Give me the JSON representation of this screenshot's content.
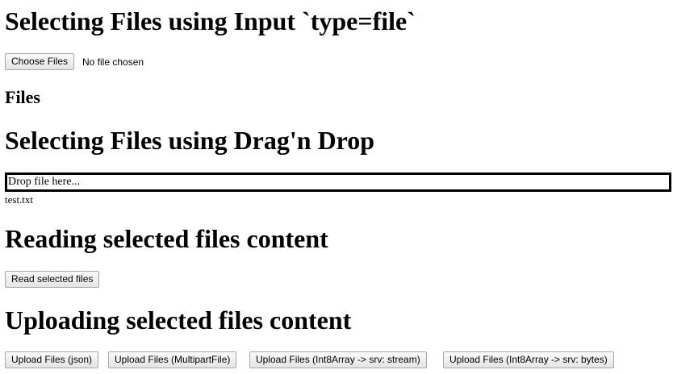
{
  "section_input": {
    "heading": "Selecting Files using Input `type=file`",
    "choose_files_label": "Choose Files",
    "file_status": "No file chosen",
    "files_subheading": "Files"
  },
  "section_drag": {
    "heading": "Selecting Files using Drag'n Drop",
    "dropzone_text": "Drop file here...",
    "files": [
      "test.txt"
    ]
  },
  "section_read": {
    "heading": "Reading selected files content",
    "read_button_label": "Read selected files"
  },
  "section_upload": {
    "heading": "Uploading selected files content",
    "buttons": [
      "Upload Files (json)",
      "Upload Files (MultipartFile)",
      "Upload Files (Int8Array -> srv: stream)",
      "Upload Files (Int8Array -> srv: bytes)"
    ]
  }
}
